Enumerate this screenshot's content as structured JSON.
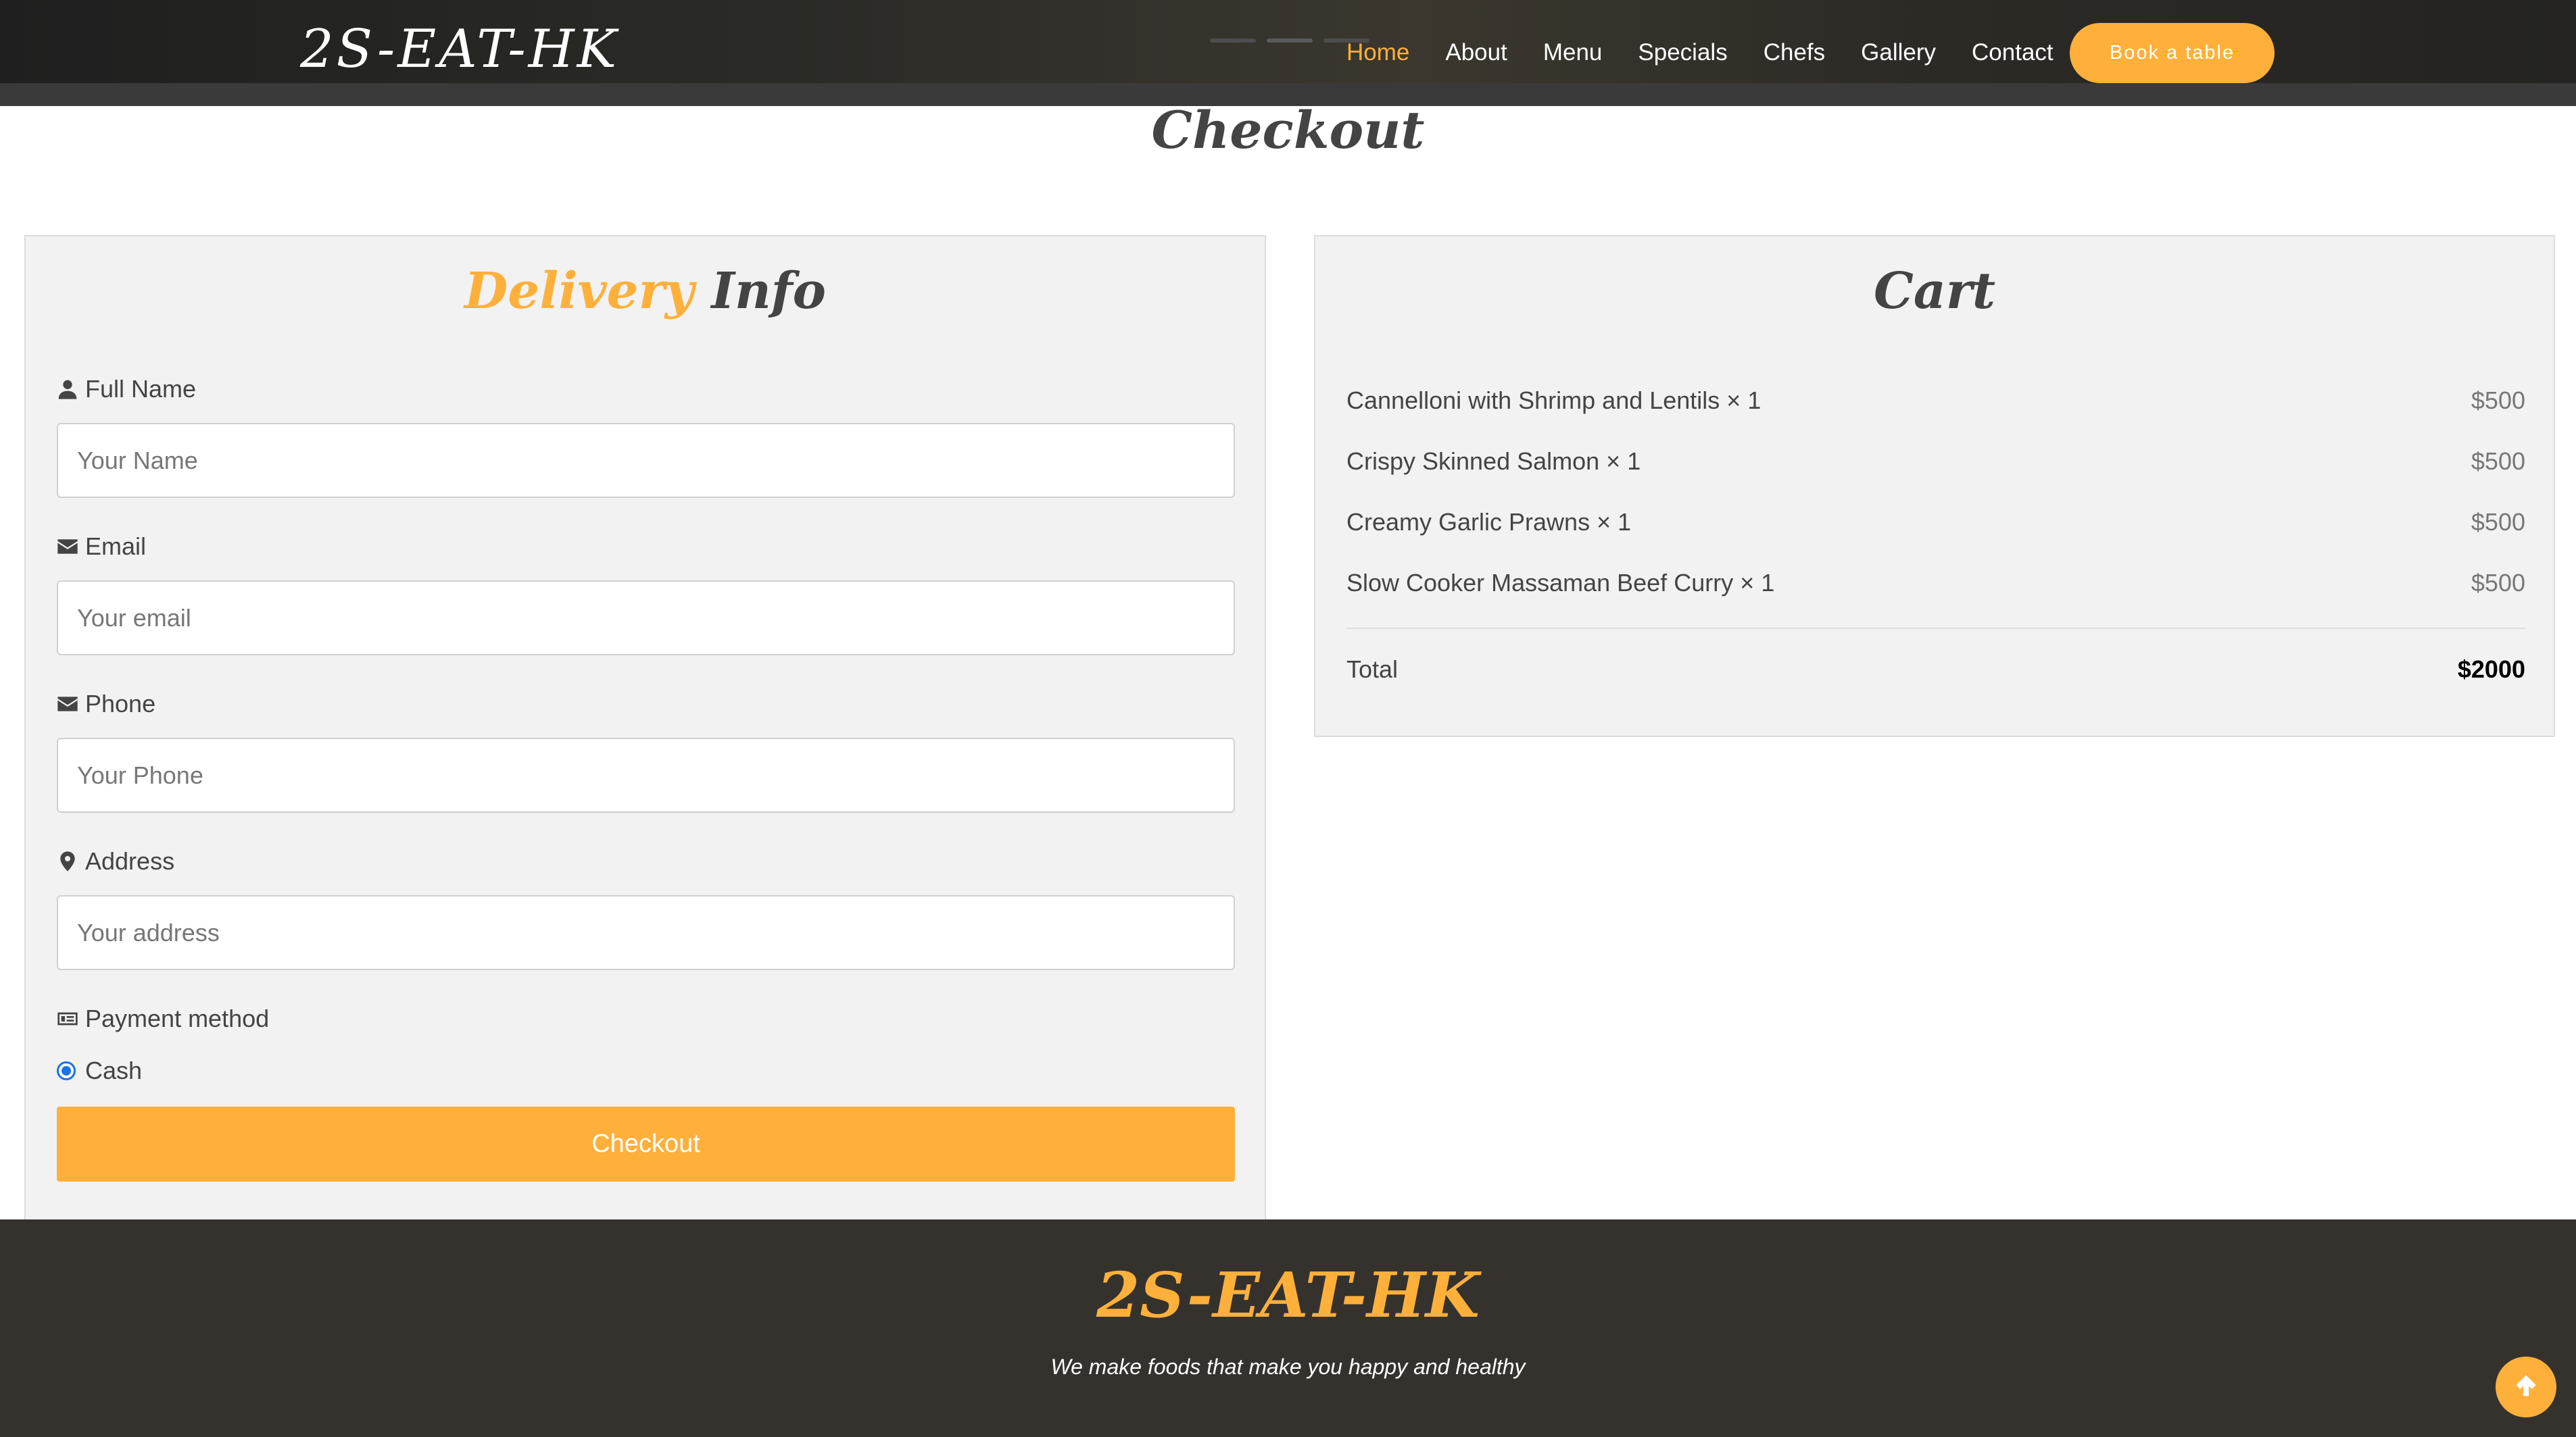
{
  "header": {
    "logo": "2S-EAT-HK",
    "nav": [
      {
        "label": "Home",
        "active": true
      },
      {
        "label": "About",
        "active": false
      },
      {
        "label": "Menu",
        "active": false
      },
      {
        "label": "Specials",
        "active": false
      },
      {
        "label": "Chefs",
        "active": false
      },
      {
        "label": "Gallery",
        "active": false
      },
      {
        "label": "Contact",
        "active": false
      }
    ],
    "book_button": "Book a table"
  },
  "page_title": "Checkout",
  "delivery": {
    "title_accent": "Delivery",
    "title_rest": "Info",
    "fields": {
      "name": {
        "label": "Full Name",
        "placeholder": "Your Name",
        "value": "",
        "icon": "user-icon"
      },
      "email": {
        "label": "Email",
        "placeholder": "Your email",
        "value": "",
        "icon": "envelope-icon"
      },
      "phone": {
        "label": "Phone",
        "placeholder": "Your Phone",
        "value": "",
        "icon": "envelope-icon"
      },
      "address": {
        "label": "Address",
        "placeholder": "Your address",
        "value": "",
        "icon": "map-marker-icon"
      }
    },
    "payment": {
      "label": "Payment method",
      "icon": "money-bill-icon",
      "options": [
        {
          "label": "Cash",
          "selected": true
        }
      ]
    },
    "checkout_button": "Checkout"
  },
  "cart": {
    "title": "Cart",
    "items": [
      {
        "name": "Cannelloni with Shrimp and Lentils × 1",
        "price": "$500"
      },
      {
        "name": "Crispy Skinned Salmon × 1",
        "price": "$500"
      },
      {
        "name": "Creamy Garlic Prawns × 1",
        "price": "$500"
      },
      {
        "name": "Slow Cooker Massaman Beef Curry × 1",
        "price": "$500"
      }
    ],
    "total_label": "Total",
    "total_value": "$2000"
  },
  "footer": {
    "logo": "2S-EAT-HK",
    "tagline": "We make foods that make you happy and healthy"
  },
  "colors": {
    "accent": "#ffb03b",
    "dark": "#35322d",
    "text": "#444444"
  },
  "icons": {
    "back_to_top": "arrow-up-icon"
  }
}
